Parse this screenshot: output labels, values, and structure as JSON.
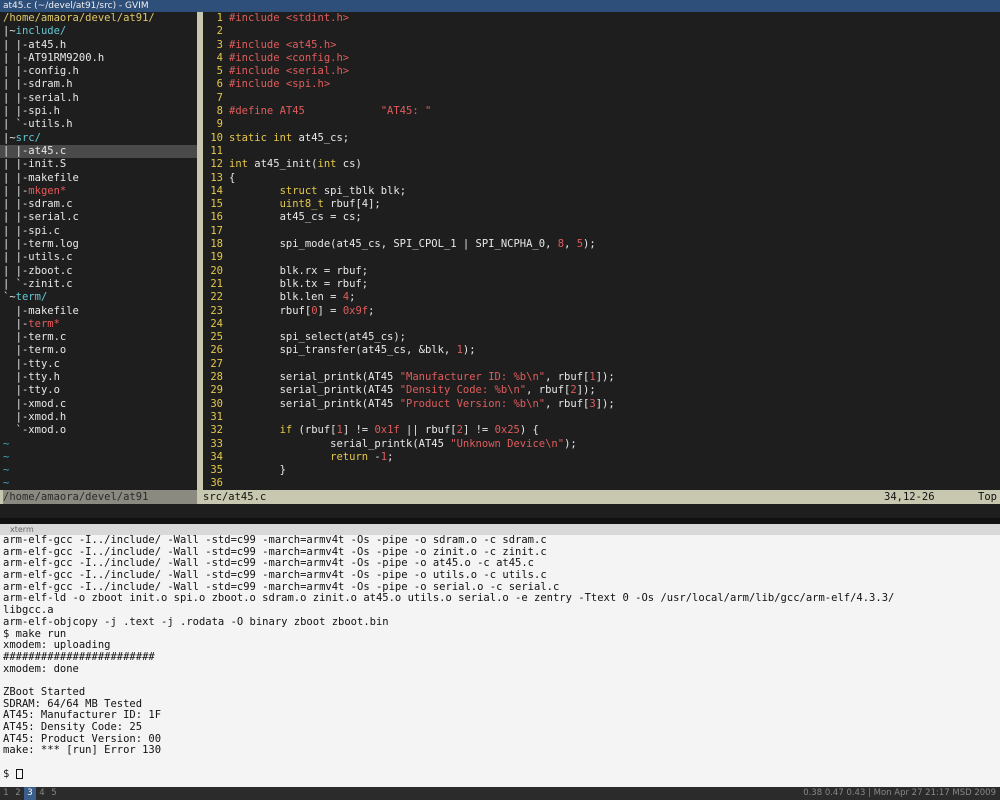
{
  "window_title": "at45.c (~/devel/at91/src) - GVIM",
  "tree": {
    "root": "/home/amaora/devel/at91/",
    "lines": [
      {
        "p": "|~",
        "t": "include/",
        "c": "dir"
      },
      {
        "p": "| |-",
        "t": "at45.h",
        "c": ""
      },
      {
        "p": "| |-",
        "t": "AT91RM9200.h",
        "c": ""
      },
      {
        "p": "| |-",
        "t": "config.h",
        "c": ""
      },
      {
        "p": "| |-",
        "t": "sdram.h",
        "c": ""
      },
      {
        "p": "| |-",
        "t": "serial.h",
        "c": ""
      },
      {
        "p": "| |-",
        "t": "spi.h",
        "c": ""
      },
      {
        "p": "| `-",
        "t": "utils.h",
        "c": ""
      },
      {
        "p": "|~",
        "t": "src/",
        "c": "dir"
      },
      {
        "p": "| |-",
        "t": "at45.c",
        "c": "",
        "hl": true
      },
      {
        "p": "| |-",
        "t": "init.S",
        "c": ""
      },
      {
        "p": "| |-",
        "t": "makefile",
        "c": ""
      },
      {
        "p": "| |-",
        "t": "mkgen*",
        "c": "red"
      },
      {
        "p": "| |-",
        "t": "sdram.c",
        "c": ""
      },
      {
        "p": "| |-",
        "t": "serial.c",
        "c": ""
      },
      {
        "p": "| |-",
        "t": "spi.c",
        "c": ""
      },
      {
        "p": "| |-",
        "t": "term.log",
        "c": ""
      },
      {
        "p": "| |-",
        "t": "utils.c",
        "c": ""
      },
      {
        "p": "| |-",
        "t": "zboot.c",
        "c": ""
      },
      {
        "p": "| `-",
        "t": "zinit.c",
        "c": ""
      },
      {
        "p": "`~",
        "t": "term/",
        "c": "dir"
      },
      {
        "p": "  |-",
        "t": "makefile",
        "c": ""
      },
      {
        "p": "  |-",
        "t": "term*",
        "c": "red"
      },
      {
        "p": "  |-",
        "t": "term.c",
        "c": ""
      },
      {
        "p": "  |-",
        "t": "term.o",
        "c": ""
      },
      {
        "p": "  |-",
        "t": "tty.c",
        "c": ""
      },
      {
        "p": "  |-",
        "t": "tty.h",
        "c": ""
      },
      {
        "p": "  |-",
        "t": "tty.o",
        "c": ""
      },
      {
        "p": "  |-",
        "t": "xmod.c",
        "c": ""
      },
      {
        "p": "  |-",
        "t": "xmod.h",
        "c": ""
      },
      {
        "p": "  `-",
        "t": "xmod.o",
        "c": ""
      }
    ],
    "tildes": [
      "~",
      "~",
      "~",
      "~"
    ]
  },
  "code": [
    [
      [
        "pre",
        "#include <stdint.h>"
      ]
    ],
    [],
    [
      [
        "pre",
        "#include <at45.h>"
      ]
    ],
    [
      [
        "pre",
        "#include <config.h>"
      ]
    ],
    [
      [
        "pre",
        "#include <serial.h>"
      ]
    ],
    [
      [
        "pre",
        "#include <spi.h>"
      ]
    ],
    [],
    [
      [
        "pre",
        "#define AT45            \"AT45: \""
      ]
    ],
    [],
    [
      [
        "kw",
        "static"
      ],
      [
        "",
        " "
      ],
      [
        "type",
        "int"
      ],
      [
        "",
        " at45_cs;"
      ]
    ],
    [],
    [
      [
        "type",
        "int"
      ],
      [
        "",
        " at45_init("
      ],
      [
        "type",
        "int"
      ],
      [
        "",
        " cs)"
      ]
    ],
    [
      [
        "",
        "{"
      ]
    ],
    [
      [
        "",
        "        "
      ],
      [
        "kw",
        "struct"
      ],
      [
        "",
        " spi_tblk blk;"
      ]
    ],
    [
      [
        "",
        "        "
      ],
      [
        "type",
        "uint8_t"
      ],
      [
        "",
        " rbuf[4];"
      ]
    ],
    [
      [
        "",
        "        at45_cs = cs;"
      ]
    ],
    [],
    [
      [
        "",
        "        spi_mode(at45_cs, SPI_CPOL_1 | SPI_NCPHA_0, "
      ],
      [
        "num",
        "8"
      ],
      [
        "",
        ", "
      ],
      [
        "num",
        "5"
      ],
      [
        "",
        ");"
      ]
    ],
    [],
    [
      [
        "",
        "        blk.rx = rbuf;"
      ]
    ],
    [
      [
        "",
        "        blk.tx = rbuf;"
      ]
    ],
    [
      [
        "",
        "        blk.len = "
      ],
      [
        "num",
        "4"
      ],
      [
        "",
        ";"
      ]
    ],
    [
      [
        "",
        "        rbuf["
      ],
      [
        "num",
        "0"
      ],
      [
        "",
        "] = "
      ],
      [
        "num",
        "0x9f"
      ],
      [
        "",
        ";"
      ]
    ],
    [],
    [
      [
        "",
        "        spi_select(at45_cs);"
      ]
    ],
    [
      [
        "",
        "        spi_transfer(at45_cs, &blk, "
      ],
      [
        "num",
        "1"
      ],
      [
        "",
        ");"
      ]
    ],
    [],
    [
      [
        "",
        "        serial_printk(AT45 "
      ],
      [
        "str",
        "\"Manufacturer ID: %b\\n\""
      ],
      [
        "",
        ", rbuf["
      ],
      [
        "num",
        "1"
      ],
      [
        "",
        "]);"
      ]
    ],
    [
      [
        "",
        "        serial_printk(AT45 "
      ],
      [
        "str",
        "\"Density Code: %b\\n\""
      ],
      [
        "",
        ", rbuf["
      ],
      [
        "num",
        "2"
      ],
      [
        "",
        "]);"
      ]
    ],
    [
      [
        "",
        "        serial_printk(AT45 "
      ],
      [
        "str",
        "\"Product Version: %b\\n\""
      ],
      [
        "",
        ", rbuf["
      ],
      [
        "num",
        "3"
      ],
      [
        "",
        "]);"
      ]
    ],
    [],
    [
      [
        "",
        "        "
      ],
      [
        "kw",
        "if"
      ],
      [
        "",
        " (rbuf["
      ],
      [
        "num",
        "1"
      ],
      [
        "",
        "] != "
      ],
      [
        "num",
        "0x1f"
      ],
      [
        "",
        " || rbuf["
      ],
      [
        "num",
        "2"
      ],
      [
        "",
        "] != "
      ],
      [
        "num",
        "0x25"
      ],
      [
        "",
        ") {"
      ]
    ],
    [
      [
        "",
        "                serial_printk(AT45 "
      ],
      [
        "str",
        "\"Unknown Device\\n\""
      ],
      [
        "",
        ");"
      ]
    ],
    [
      [
        "",
        "                "
      ],
      [
        "kw",
        "return"
      ],
      [
        "",
        " -"
      ],
      [
        "num",
        "1"
      ],
      [
        "",
        ";"
      ]
    ],
    [
      [
        "",
        "        }"
      ]
    ],
    []
  ],
  "status": {
    "left": "/home/amaora/devel/at91",
    "file": "src/at45.c",
    "position": "34,12-26",
    "scroll": "Top"
  },
  "xterm_title": "xterm",
  "terminal": [
    "arm-elf-gcc -I../include/ -Wall -std=c99 -march=armv4t -Os -pipe -o sdram.o -c sdram.c",
    "arm-elf-gcc -I../include/ -Wall -std=c99 -march=armv4t -Os -pipe -o zinit.o -c zinit.c",
    "arm-elf-gcc -I../include/ -Wall -std=c99 -march=armv4t -Os -pipe -o at45.o -c at45.c",
    "arm-elf-gcc -I../include/ -Wall -std=c99 -march=armv4t -Os -pipe -o utils.o -c utils.c",
    "arm-elf-gcc -I../include/ -Wall -std=c99 -march=armv4t -Os -pipe -o serial.o -c serial.c",
    "arm-elf-ld -o zboot init.o spi.o zboot.o sdram.o zinit.o at45.o utils.o serial.o -e zentry -Ttext 0 -Os /usr/local/arm/lib/gcc/arm-elf/4.3.3/",
    "libgcc.a",
    "arm-elf-objcopy -j .text -j .rodata -O binary zboot zboot.bin",
    "$ make run",
    "xmodem: uploading",
    "########################",
    "xmodem: done",
    "",
    "ZBoot Started",
    "SDRAM: 64/64 MB Tested",
    "AT45: Manufacturer ID: 1F",
    "AT45: Density Code: 25",
    "AT45: Product Version: 00",
    "make: *** [run] Error 130",
    "",
    "$ "
  ],
  "panel": {
    "workspaces": [
      "1",
      "2",
      "3",
      "4",
      "5"
    ],
    "active_workspace": "3",
    "sysinfo": "0.38 0.47 0.43 | Mon Apr 27 21:17 MSD 2009"
  }
}
